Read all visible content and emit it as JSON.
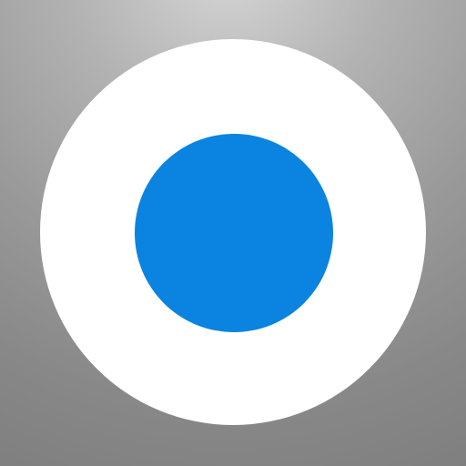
{
  "icon": {
    "name": "record-dot-icon",
    "colors": {
      "background_top": "#d6d6d6",
      "background_bottom": "#7f7f7f",
      "ring": "#ffffff",
      "dot": "#0a84e0"
    }
  }
}
